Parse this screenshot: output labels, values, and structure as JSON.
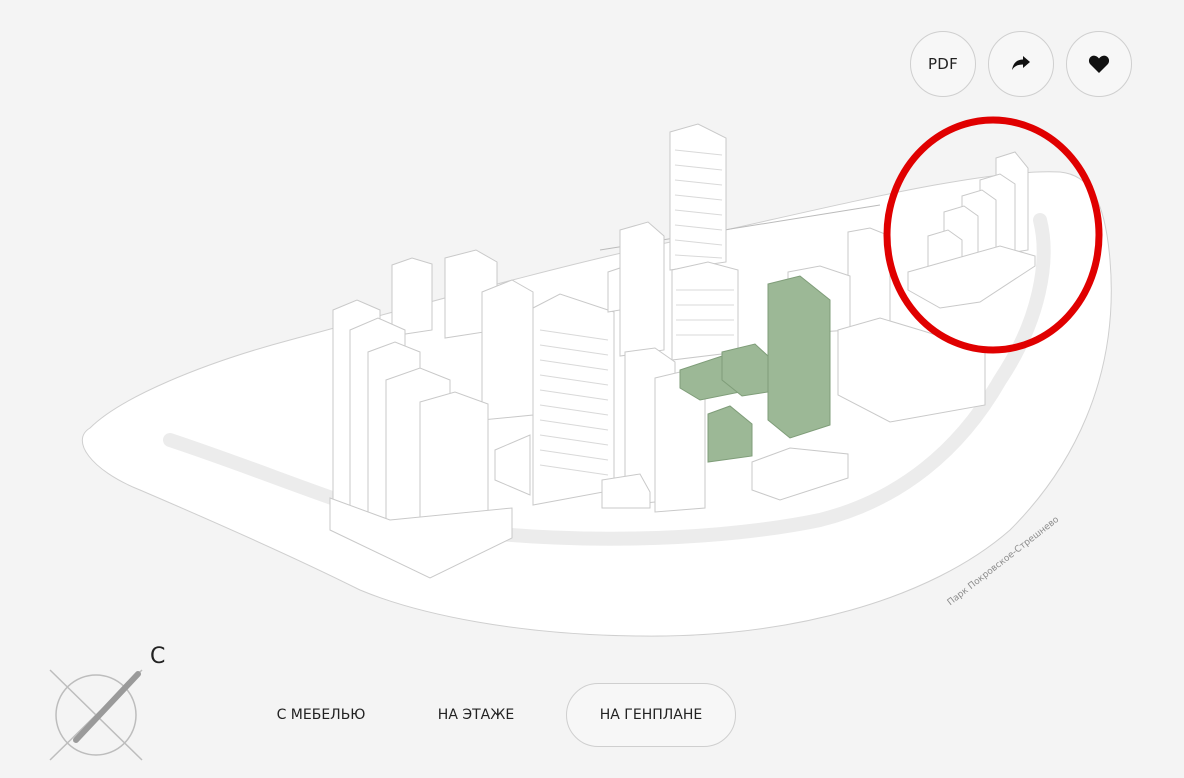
{
  "toolbar": {
    "pdf_label": "PDF",
    "share_icon": "share-arrow-icon",
    "favorite_icon": "heart-icon"
  },
  "map": {
    "park_label": "Парк Покровское-Стрешнево",
    "highlight_color": "#9cb896",
    "marker_color": "#e00000"
  },
  "compass": {
    "letter": "С"
  },
  "view_tabs": [
    {
      "label": "С МЕБЕЛЬЮ",
      "active": false
    },
    {
      "label": "НА ЭТАЖЕ",
      "active": false
    },
    {
      "label": "НА ГЕНПЛАНЕ",
      "active": true
    }
  ]
}
